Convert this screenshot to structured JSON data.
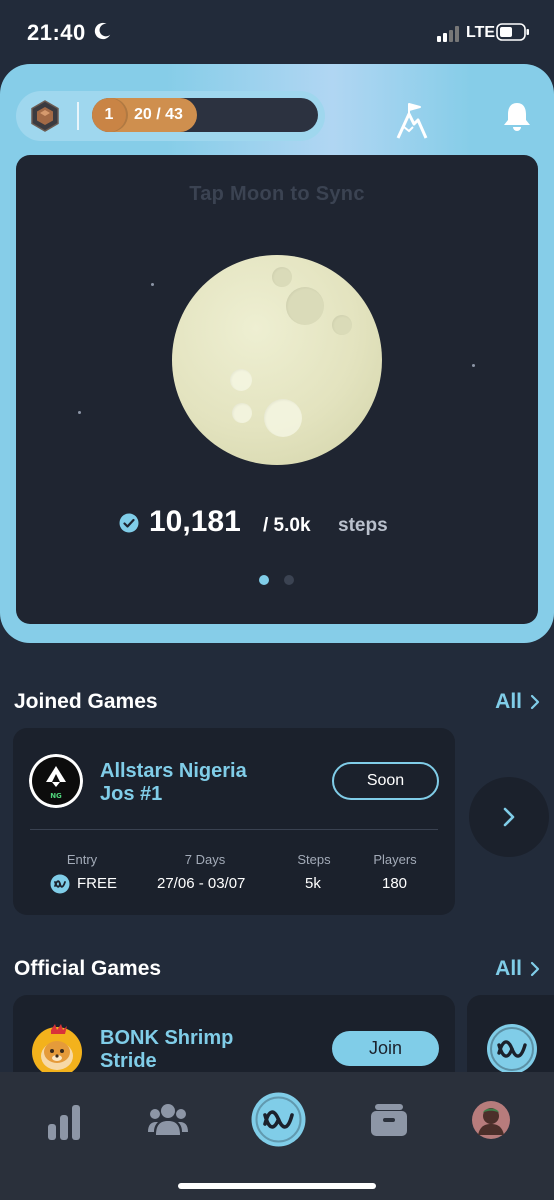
{
  "status_bar": {
    "time": "21:40",
    "network": "LTE",
    "dnd_icon": "moon-icon",
    "signal_icon": "signal-icon",
    "battery_icon": "battery-icon"
  },
  "header": {
    "level": "1",
    "xp_text": "20 / 43",
    "xp_progress": 0.465,
    "rank_icon": "rank-badge-icon",
    "flag_icon": "mountain-flag-icon",
    "bell_icon": "bell-icon"
  },
  "moon_card": {
    "hint": "Tap Moon to Sync",
    "steps": "10,181",
    "goal": "/ 5.0k",
    "unit": "steps",
    "page_count": 2,
    "active_page": 1
  },
  "joined_games": {
    "title": "Joined Games",
    "all_label": "All",
    "card": {
      "name_line1": "Allstars Nigeria",
      "name_line2": "Jos #1",
      "status_button": "Soon",
      "stats": [
        {
          "label": "Entry",
          "value": "FREE"
        },
        {
          "label": "7 Days",
          "value": "27/06 - 03/07"
        },
        {
          "label": "Steps",
          "value": "5k"
        },
        {
          "label": "Players",
          "value": "180"
        }
      ]
    }
  },
  "official_games": {
    "title": "Official Games",
    "all_label": "All",
    "card": {
      "name_line1": "BONK Shrimp",
      "name_line2": "Stride",
      "action_button": "Join"
    }
  },
  "nav": {
    "items": [
      "leaderboard-icon",
      "community-icon",
      "home-icon",
      "wallet-icon",
      "profile-avatar"
    ]
  },
  "colors": {
    "accent": "#80cde8",
    "panel": "#86cde8",
    "background": "#222b3a",
    "card": "#1b212c",
    "xp_fill": "#cf8f4e"
  }
}
